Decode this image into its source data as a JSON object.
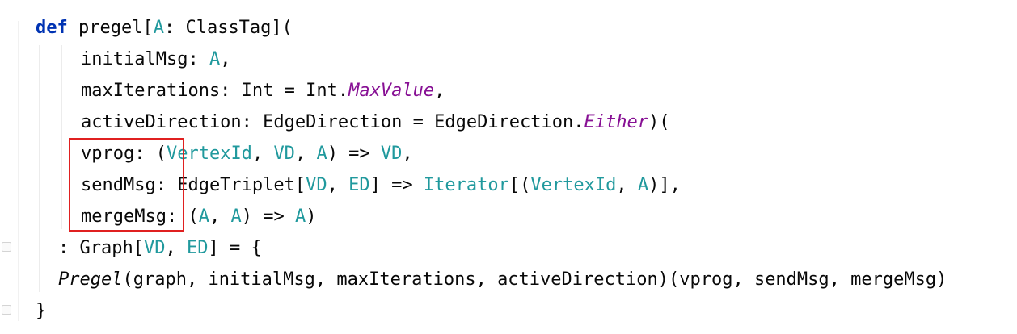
{
  "code": {
    "l1": {
      "kw": "def",
      "name": " pregel[",
      "tp": "A",
      "rest": ": ClassTag]("
    },
    "l2": {
      "name": "initialMsg: ",
      "tp": "A",
      "rest": ","
    },
    "l3": {
      "name": "maxIterations: Int = Int.",
      "it": "MaxValue",
      "rest": ","
    },
    "l4": {
      "name": "activeDirection: EdgeDirection = EdgeDirection.",
      "it": "Either",
      "rest": ")("
    },
    "l5": {
      "name": "vprog: (",
      "tp1": "VertexId",
      "sep1": ", ",
      "tp2": "VD",
      "sep2": ", ",
      "tp3": "A",
      "mid": ") => ",
      "tp4": "VD",
      "rest": ","
    },
    "l6": {
      "name": "sendMsg: EdgeTriplet[",
      "tp1": "VD",
      "sep1": ", ",
      "tp2": "ED",
      "mid": "] => ",
      "tp3": "Iterator",
      "mid2": "[(",
      "tp4": "VertexId",
      "sep2": ", ",
      "tp5": "A",
      "rest": ")],"
    },
    "l7": {
      "name": "mergeMsg: (",
      "tp1": "A",
      "sep1": ", ",
      "tp2": "A",
      "mid": ") => ",
      "tp3": "A",
      "rest": ")"
    },
    "l8": {
      "name": ": Graph[",
      "tp1": "VD",
      "sep1": ", ",
      "tp2": "ED",
      "rest": "] = {"
    },
    "l9": {
      "it": "Pregel",
      "rest": "(graph, initialMsg, maxIterations, activeDirection)(vprog, sendMsg, mergeMsg)"
    },
    "l10": {
      "rest": "}"
    }
  },
  "colors": {
    "keyword": "#0033b3",
    "type_param": "#20999d",
    "italic_member": "#871094",
    "highlight_border": "#e02020"
  }
}
